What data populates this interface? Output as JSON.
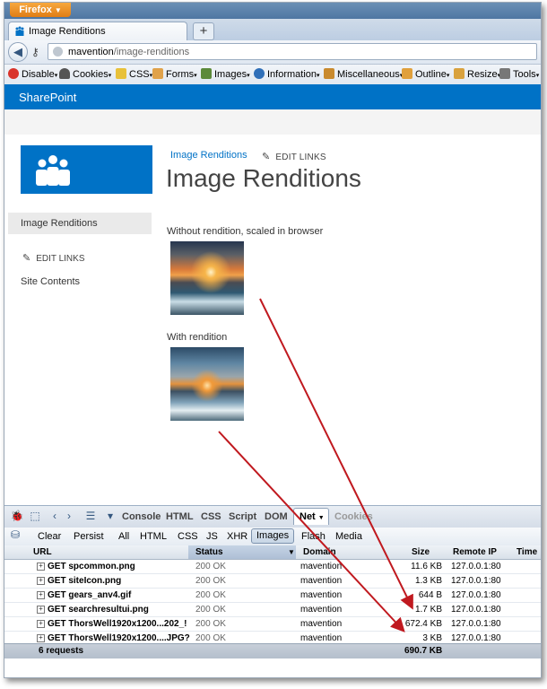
{
  "browser": {
    "menu_button": "Firefox",
    "tab_title": "Image Renditions",
    "url_host": "mavention",
    "url_path": "/image-renditions"
  },
  "webdev_toolbar": {
    "items": [
      "Disable",
      "Cookies",
      "CSS",
      "Forms",
      "Images",
      "Information",
      "Miscellaneous",
      "Outline",
      "Resize",
      "Tools"
    ]
  },
  "sharepoint": {
    "suite_title": "SharePoint",
    "breadcrumb": "Image Renditions",
    "edit_links": "EDIT LINKS",
    "page_title": "Image Renditions",
    "left_nav": {
      "active_item": "Image Renditions",
      "edit_links": "EDIT LINKS",
      "site_contents": "Site Contents"
    },
    "caption_without": "Without rendition, scaled in browser",
    "caption_with": "With rendition"
  },
  "firebug": {
    "panels": [
      "Console",
      "HTML",
      "CSS",
      "Script",
      "DOM",
      "Net",
      "Cookies"
    ],
    "active_panel": "Net",
    "net_toolbar": [
      "Clear",
      "Persist",
      "All",
      "HTML",
      "CSS",
      "JS",
      "XHR",
      "Images",
      "Flash",
      "Media"
    ],
    "active_filter": "Images",
    "columns": [
      "URL",
      "Status",
      "Domain",
      "Size",
      "Remote IP",
      "Time"
    ],
    "rows": [
      {
        "url": "GET spcommon.png",
        "status": "200 OK",
        "domain": "mavention",
        "size": "11.6 KB",
        "ip": "127.0.0.1:80"
      },
      {
        "url": "GET siteIcon.png",
        "status": "200 OK",
        "domain": "mavention",
        "size": "1.3 KB",
        "ip": "127.0.0.1:80"
      },
      {
        "url": "GET gears_anv4.gif",
        "status": "200 OK",
        "domain": "mavention",
        "size": "644 B",
        "ip": "127.0.0.1:80"
      },
      {
        "url": "GET searchresultui.png",
        "status": "200 OK",
        "domain": "mavention",
        "size": "1.7 KB",
        "ip": "127.0.0.1:80"
      },
      {
        "url": "GET ThorsWell1920x1200...202_!",
        "status": "200 OK",
        "domain": "mavention",
        "size": "672.4 KB",
        "ip": "127.0.0.1:80"
      },
      {
        "url": "GET ThorsWell1920x1200....JPG?",
        "status": "200 OK",
        "domain": "mavention",
        "size": "3 KB",
        "ip": "127.0.0.1:80"
      }
    ],
    "summary_requests": "6 requests",
    "summary_size": "690.7 KB"
  },
  "colors": {
    "sharepoint_blue": "#0072c6",
    "arrow_red": "#c0191f"
  }
}
